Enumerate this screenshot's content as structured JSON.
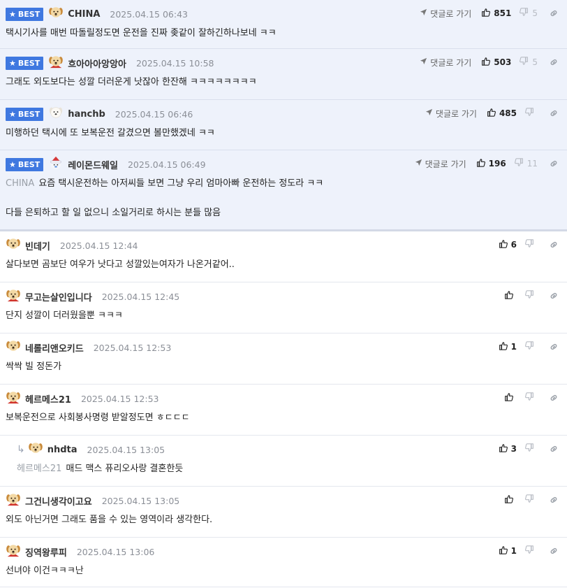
{
  "best_label": "BEST",
  "goto_label": "댓글로 가기",
  "comments": [
    {
      "best": true,
      "reply": false,
      "avatar": "dog-avatar",
      "nick": "CHINA",
      "date": "2025.04.15 06:43",
      "likes": "851",
      "dislikes": "5",
      "mention": "",
      "text": "택시기사를 매번 따돌릴정도면 운전을 진짜 좆같이 잘하긴하나보네 ㅋㅋ",
      "text2": ""
    },
    {
      "best": true,
      "reply": false,
      "avatar": "dog-red-avatar",
      "nick": "흐아아아앙앙아",
      "date": "2025.04.15 10:58",
      "likes": "503",
      "dislikes": "5",
      "mention": "",
      "text": "그래도 외도보다는 성깔 더러운게 낫잖아 한잔해 ㅋㅋㅋㅋㅋㅋㅋㅋ",
      "text2": ""
    },
    {
      "best": true,
      "reply": false,
      "avatar": "white-dog-avatar",
      "nick": "hanchb",
      "date": "2025.04.15 06:46",
      "likes": "485",
      "dislikes": "",
      "mention": "",
      "text": "미행하던 택시에 또 보복운전 갈겼으면 볼만했겠네 ㅋㅋ",
      "text2": ""
    },
    {
      "best": true,
      "reply": false,
      "avatar": "santa-avatar",
      "nick": "레이몬드웨일",
      "date": "2025.04.15 06:49",
      "likes": "196",
      "dislikes": "11",
      "mention": "CHINA",
      "text": "요즘 택시운전하는 아저씨들 보면 그냥 우리 엄마아빠 운전하는 정도라 ㅋㅋ",
      "text2": "다들 은퇴하고 할 일 없으니 소일거리로 하시는 분들 많음"
    },
    {
      "best": false,
      "reply": false,
      "avatar": "dog-avatar",
      "nick": "빈데기",
      "date": "2025.04.15 12:44",
      "likes": "6",
      "dislikes": "",
      "mention": "",
      "text": "살다보면 곰보단 여우가 낫다고 성깔있는여자가 나온거같어..",
      "text2": ""
    },
    {
      "best": false,
      "reply": false,
      "avatar": "dog-red-avatar",
      "nick": "무고는살인입니다",
      "date": "2025.04.15 12:45",
      "likes": "",
      "dislikes": "",
      "mention": "",
      "text": "단지 성깔이 더러웠을뿐 ㅋㅋㅋ",
      "text2": ""
    },
    {
      "best": false,
      "reply": false,
      "avatar": "dog-avatar",
      "nick": "네롤리앤오키드",
      "date": "2025.04.15 12:53",
      "likes": "1",
      "dislikes": "",
      "mention": "",
      "text": "싹싹 빌 정돈가",
      "text2": ""
    },
    {
      "best": false,
      "reply": false,
      "avatar": "dog-red-avatar",
      "nick": "헤르메스21",
      "date": "2025.04.15 12:53",
      "likes": "",
      "dislikes": "",
      "mention": "",
      "text": "보복운전으로 사회봉사명령 받알정도면 ㅎㄷㄷㄷ",
      "text2": ""
    },
    {
      "best": false,
      "reply": true,
      "avatar": "dog-avatar",
      "nick": "nhdta",
      "date": "2025.04.15 13:05",
      "likes": "3",
      "dislikes": "",
      "mention": "헤르메스21",
      "text": "매드 맥스 퓨리오사랑 결혼한듯",
      "text2": ""
    },
    {
      "best": false,
      "reply": false,
      "avatar": "dog-red-avatar",
      "nick": "그건니생각이고요",
      "date": "2025.04.15 13:05",
      "likes": "",
      "dislikes": "",
      "mention": "",
      "text": "외도 아닌거면 그래도 품을 수 있는 영역이라 생각한다.",
      "text2": ""
    },
    {
      "best": false,
      "reply": false,
      "avatar": "dog-red-avatar",
      "nick": "징역왕루피",
      "date": "2025.04.15 13:06",
      "likes": "1",
      "dislikes": "",
      "mention": "",
      "text": "선녀야 이건ㅋㅋㅋ난",
      "text2": ""
    }
  ]
}
